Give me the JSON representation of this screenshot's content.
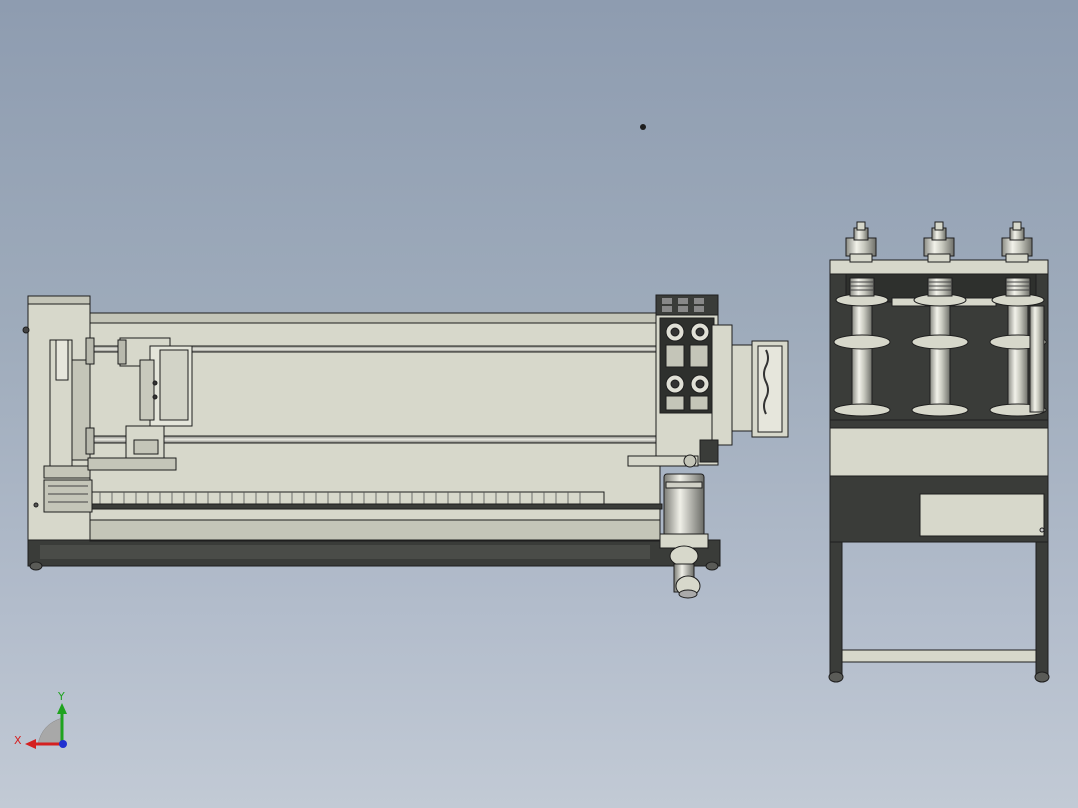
{
  "viewport": {
    "background_top": "#8e9cb0",
    "background_bottom": "#c2cad5"
  },
  "triad": {
    "x_label": "X",
    "y_label": "Y",
    "x_color": "#d42020",
    "y_color": "#1fa31f",
    "z_color": "#2030d0"
  },
  "model": {
    "views": [
      "front-view",
      "side-view"
    ],
    "metal_light": "#d7d8cb",
    "metal_mid": "#c4c5b8",
    "dark_part": "#3a3c39",
    "edge": "#1e1e1e"
  }
}
